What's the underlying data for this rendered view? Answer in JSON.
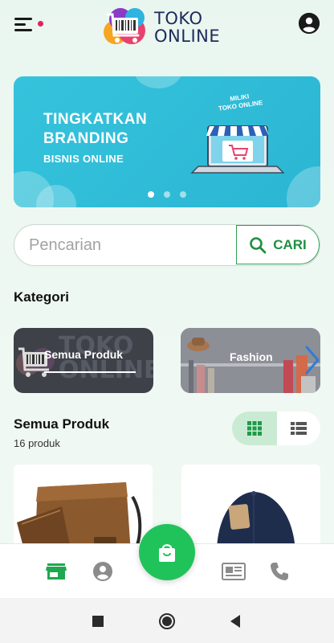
{
  "header": {
    "logo_line1": "TOKO",
    "logo_line2": "ONLINE",
    "menu_icon": "hamburger-menu-icon",
    "account_icon": "account-circle-icon",
    "notification_dot_color": "#e0245e"
  },
  "banner": {
    "tag_line1": "MILIKI",
    "tag_line2": "TOKO ONLINE",
    "title_line1": "TINGKATKAN",
    "title_line2": "BRANDING",
    "subtitle": "BISNIS ONLINE",
    "slide_count": 3,
    "active_slide": 1
  },
  "search": {
    "placeholder": "Pencarian",
    "value": "",
    "button_label": "CARI",
    "accent": "#1e8f42"
  },
  "categories": {
    "title": "Kategori",
    "items": [
      {
        "label": "Semua Produk",
        "selected": true
      },
      {
        "label": "Fashion",
        "selected": false
      }
    ],
    "watermark_line1": "TOKO",
    "watermark_line2": "ONLINE"
  },
  "products": {
    "title": "Semua Produk",
    "count_label": "16 produk",
    "view_mode": "grid",
    "items": [
      {
        "image": "leather-bag"
      },
      {
        "image": "navy-cap"
      }
    ]
  },
  "bottom_nav": {
    "items": [
      {
        "icon": "store-icon",
        "active": true
      },
      {
        "icon": "account-icon",
        "active": false
      },
      {
        "icon": "shopping-bag-icon",
        "active": false
      },
      {
        "icon": "newspaper-icon",
        "active": false
      },
      {
        "icon": "phone-icon",
        "active": false
      }
    ],
    "active_color": "#1fa84f",
    "fab_color": "#20c35a"
  },
  "system_nav": [
    "recents-icon",
    "home-icon",
    "back-icon"
  ]
}
